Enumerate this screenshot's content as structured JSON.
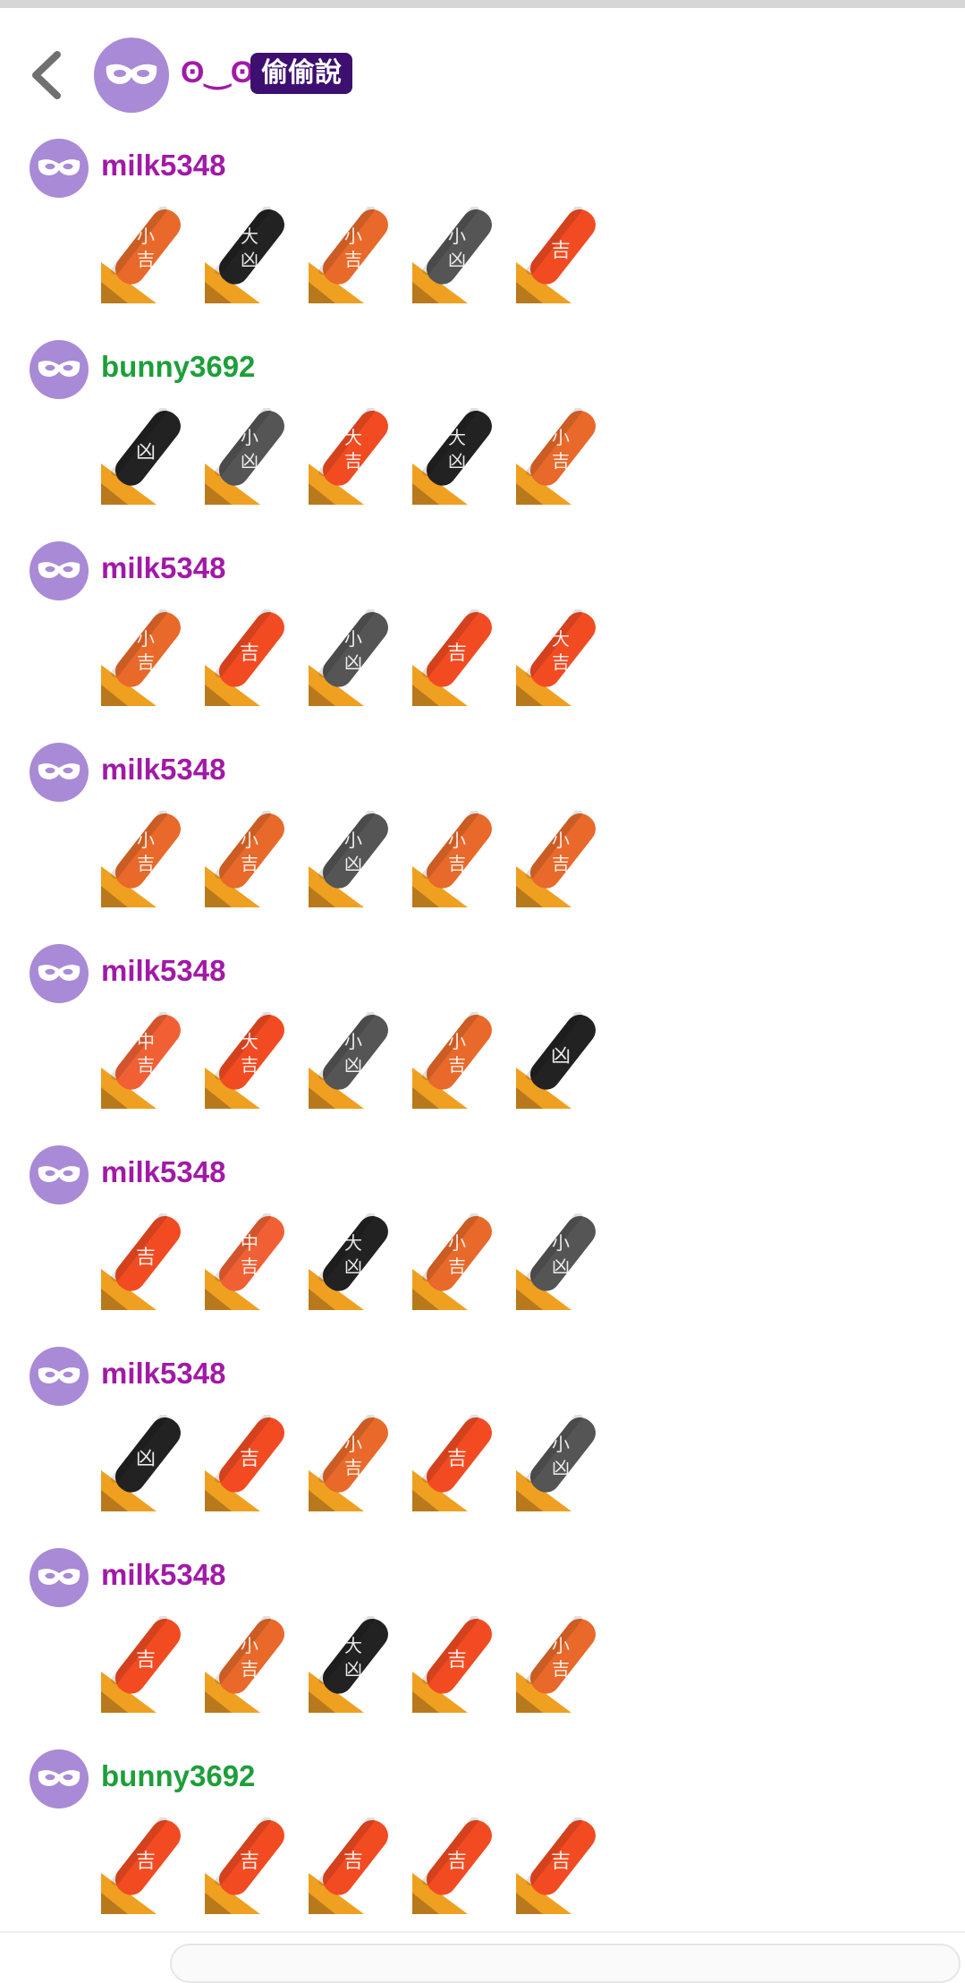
{
  "header": {
    "nickname": "ʘ‿ʘ",
    "badge": "偷偷說",
    "back_icon": "chevron-left-icon",
    "avatar_icon": "mask-icon"
  },
  "colors": {
    "avatar_bg": "#a98ad6",
    "name_milk": "#a11aa6",
    "name_bunny": "#1e9e3a",
    "badge_bg": "#3d0f70",
    "stick_orange": "#e8692a",
    "stick_red": "#f24b22",
    "stick_redorange": "#f06034",
    "stick_gray": "#555555",
    "stick_black": "#222222",
    "base_gold": "#f0a020"
  },
  "messages": [
    {
      "user": "milk5348",
      "sticks": [
        {
          "label": "小吉"
        },
        {
          "label": "大凶"
        },
        {
          "label": "小吉"
        },
        {
          "label": "小凶"
        },
        {
          "label": "吉"
        }
      ]
    },
    {
      "user": "bunny3692",
      "sticks": [
        {
          "label": "凶"
        },
        {
          "label": "小凶"
        },
        {
          "label": "大吉"
        },
        {
          "label": "大凶"
        },
        {
          "label": "小吉"
        }
      ]
    },
    {
      "user": "milk5348",
      "sticks": [
        {
          "label": "小吉"
        },
        {
          "label": "吉"
        },
        {
          "label": "小凶"
        },
        {
          "label": "吉"
        },
        {
          "label": "大吉"
        }
      ]
    },
    {
      "user": "milk5348",
      "sticks": [
        {
          "label": "小吉"
        },
        {
          "label": "小吉"
        },
        {
          "label": "小凶"
        },
        {
          "label": "小吉"
        },
        {
          "label": "小吉"
        }
      ]
    },
    {
      "user": "milk5348",
      "sticks": [
        {
          "label": "中吉"
        },
        {
          "label": "大吉"
        },
        {
          "label": "小凶"
        },
        {
          "label": "小吉"
        },
        {
          "label": "凶"
        }
      ]
    },
    {
      "user": "milk5348",
      "sticks": [
        {
          "label": "吉"
        },
        {
          "label": "中吉"
        },
        {
          "label": "大凶"
        },
        {
          "label": "小吉"
        },
        {
          "label": "小凶"
        }
      ]
    },
    {
      "user": "milk5348",
      "sticks": [
        {
          "label": "凶"
        },
        {
          "label": "吉"
        },
        {
          "label": "小吉"
        },
        {
          "label": "吉"
        },
        {
          "label": "小凶"
        }
      ]
    },
    {
      "user": "milk5348",
      "sticks": [
        {
          "label": "吉"
        },
        {
          "label": "小吉"
        },
        {
          "label": "大凶"
        },
        {
          "label": "吉"
        },
        {
          "label": "小吉"
        }
      ]
    },
    {
      "user": "bunny3692",
      "sticks": [
        {
          "label": "吉"
        },
        {
          "label": "吉"
        },
        {
          "label": "吉"
        },
        {
          "label": "吉"
        },
        {
          "label": "吉"
        }
      ]
    }
  ]
}
